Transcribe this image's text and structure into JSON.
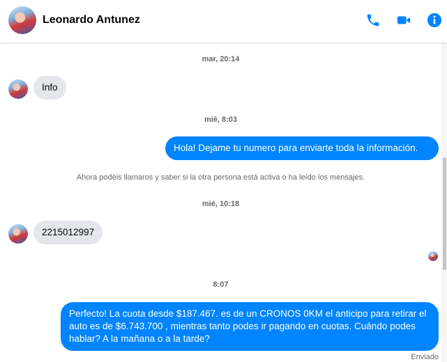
{
  "header": {
    "contact_name": "Leonardo Antunez",
    "icons": [
      "phone-icon",
      "video-camera-icon",
      "info-icon"
    ],
    "accent_color": "#0084ff"
  },
  "conversation": {
    "timestamps": [
      "mar, 20:14",
      "mié, 8:03",
      "mié, 10:18",
      "8:07"
    ],
    "system_note": "Ahora podéis llamaros y saber si la otra persona está activa o ha leído los mensajes.",
    "messages": [
      {
        "direction": "incoming",
        "text": "Info"
      },
      {
        "direction": "outgoing",
        "text": "Hola! Dejame tu numero  para enviarte toda la información."
      },
      {
        "direction": "incoming",
        "text": "2215012997"
      },
      {
        "direction": "outgoing",
        "text": "Perfecto! La cuota desde $187.467. es de un CRONOS 0KM el anticipo para retirar el auto es de $6.743.700 , mientras tanto podes ir pagando en cuotas. Cuándo podes hablar? A la mañana o a la tarde?"
      }
    ],
    "delivery_status": "Enviado"
  },
  "colors": {
    "outgoing_bubble": "#0084ff",
    "incoming_bubble": "#e4e6eb",
    "meta_text": "#65676b"
  }
}
